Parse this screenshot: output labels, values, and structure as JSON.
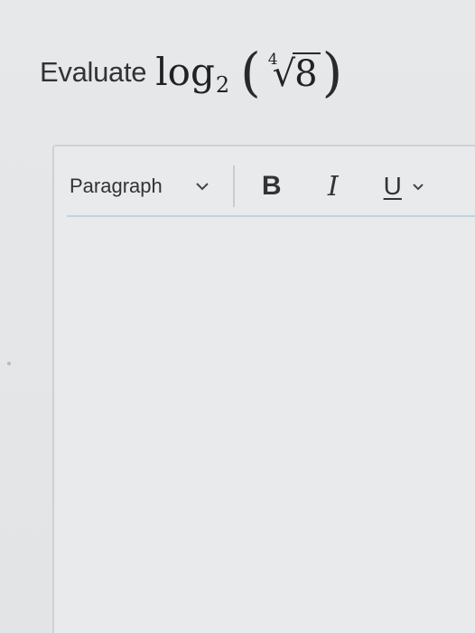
{
  "question": {
    "prefix": "Evaluate",
    "log_function": "log",
    "log_base": "2",
    "open_paren": "(",
    "close_paren": ")",
    "root_index": "4",
    "root_symbol": "√",
    "radicand": "8"
  },
  "editor": {
    "format_select_value": "Paragraph",
    "bold_label": "B",
    "italic_label": "I",
    "underline_label": "U",
    "content": ""
  },
  "icons": {
    "format_dropdown": "chevron-down-icon",
    "underline_more": "chevron-down-icon"
  },
  "colors": {
    "toolbar_underline": "#c3d2e2",
    "text": "#333333",
    "background": "#e6e8ea"
  }
}
